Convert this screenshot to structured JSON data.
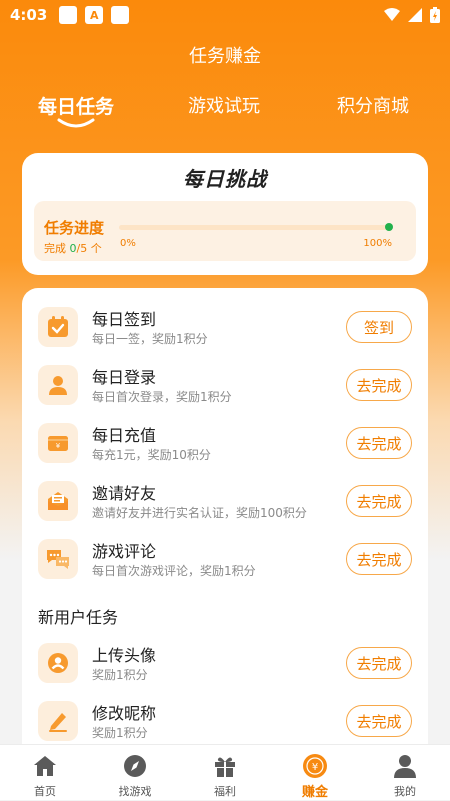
{
  "status_bar": {
    "time": "4:03",
    "notif_icons": [
      "app-icon",
      "a-icon",
      "app-icon"
    ]
  },
  "header": {
    "title": "任务赚金"
  },
  "tabs": [
    {
      "label": "每日任务",
      "active": true
    },
    {
      "label": "游戏试玩",
      "active": false
    },
    {
      "label": "积分商城",
      "active": false
    }
  ],
  "challenge": {
    "title": "每日挑战",
    "progress_label": "任务进度",
    "count_prefix": "完成",
    "count_done": "0",
    "count_total": "/5 个",
    "progress_value": 1.0,
    "start_label": "0%",
    "end_label": "100%"
  },
  "tasks": [
    {
      "name": "每日签到",
      "desc": "每日一签，奖励1积分",
      "button": "签到",
      "icon": "calendar-check-icon"
    },
    {
      "name": "每日登录",
      "desc": "每日首次登录，奖励1积分",
      "button": "去完成",
      "icon": "user-icon"
    },
    {
      "name": "每日充值",
      "desc": "每充1元，奖励10积分",
      "button": "去完成",
      "icon": "wallet-icon"
    },
    {
      "name": "邀请好友",
      "desc": "邀请好友并进行实名认证，奖励100积分",
      "button": "去完成",
      "icon": "envelope-icon"
    },
    {
      "name": "游戏评论",
      "desc": "每日首次游戏评论，奖励1积分",
      "button": "去完成",
      "icon": "comment-icon"
    }
  ],
  "new_user_section": {
    "title": "新用户任务"
  },
  "new_user_tasks": [
    {
      "name": "上传头像",
      "desc": "奖励1积分",
      "button": "去完成",
      "icon": "avatar-icon"
    },
    {
      "name": "修改昵称",
      "desc": "奖励1积分",
      "button": "去完成",
      "icon": "pencil-icon"
    }
  ],
  "bottom_nav": [
    {
      "label": "首页",
      "icon": "home-icon",
      "active": false
    },
    {
      "label": "找游戏",
      "icon": "compass-icon",
      "active": false
    },
    {
      "label": "福利",
      "icon": "gift-icon",
      "active": false
    },
    {
      "label": "赚金",
      "icon": "coin-icon",
      "active": true
    },
    {
      "label": "我的",
      "icon": "profile-icon",
      "active": false
    }
  ],
  "colors": {
    "primary": "#fb8a0b",
    "accent_text": "#f07d00",
    "progress": "#22b14c"
  }
}
